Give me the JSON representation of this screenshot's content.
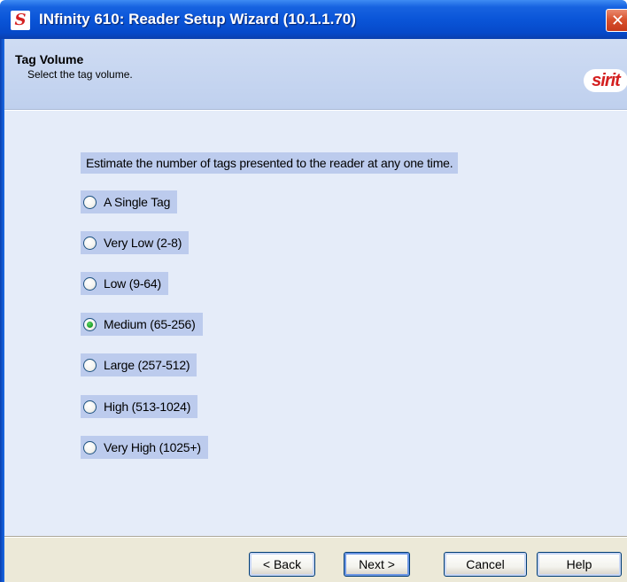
{
  "window": {
    "title": "INfinity 610: Reader Setup Wizard (10.1.1.70)",
    "app_icon": "S",
    "close_glyph": "✕"
  },
  "header": {
    "title": "Tag Volume",
    "subtitle": "Select the tag volume.",
    "logo_text": "sirit"
  },
  "body": {
    "prompt": "Estimate the number of tags presented to the reader at any one time.",
    "options": [
      {
        "label": "A Single Tag",
        "checked": false
      },
      {
        "label": "Very Low  (2-8)",
        "checked": false
      },
      {
        "label": "Low  (9-64)",
        "checked": false
      },
      {
        "label": "Medium  (65-256)",
        "checked": true
      },
      {
        "label": "Large  (257-512)",
        "checked": false
      },
      {
        "label": "High (513-1024)",
        "checked": false
      },
      {
        "label": "Very High (1025+)",
        "checked": false
      }
    ]
  },
  "footer": {
    "back_label": "< Back",
    "next_label": "Next >",
    "cancel_label": "Cancel",
    "help_label": "Help"
  },
  "colors": {
    "titlebar": "#0a55d8",
    "header_bg": "#c6d5f0",
    "content_bg": "#e5ecf9",
    "highlight": "#bccbed",
    "logo_red": "#d42020"
  }
}
